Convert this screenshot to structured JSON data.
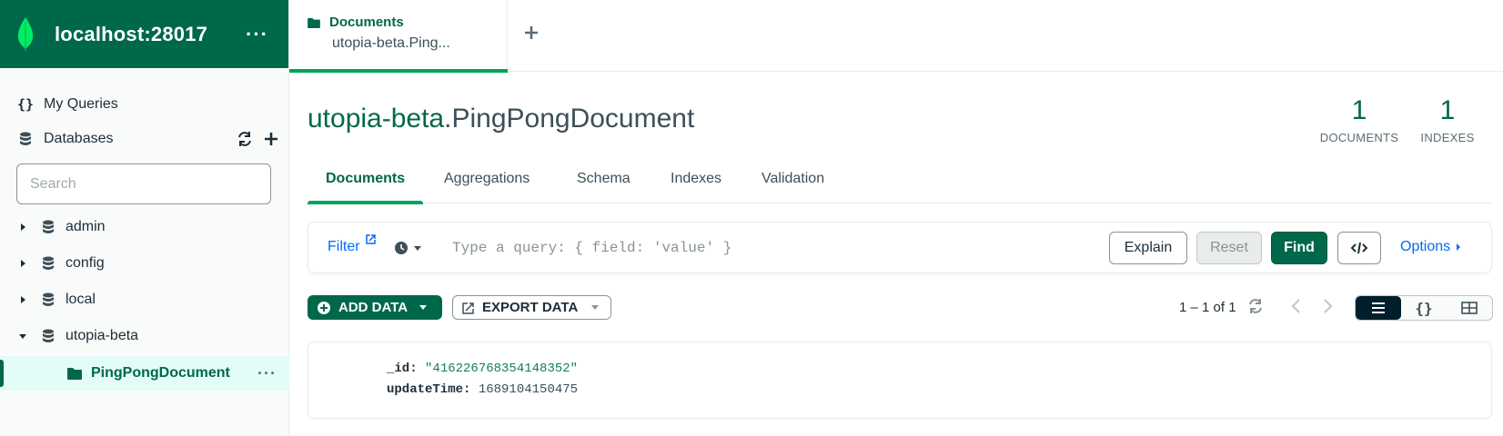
{
  "sidebar": {
    "connection_title": "localhost:28017",
    "menu_dots": "···",
    "my_queries_label": "My Queries",
    "databases_label": "Databases",
    "search_placeholder": "Search",
    "databases": [
      {
        "name": "admin",
        "expanded": false
      },
      {
        "name": "config",
        "expanded": false
      },
      {
        "name": "local",
        "expanded": false
      },
      {
        "name": "utopia-beta",
        "expanded": true
      }
    ],
    "selected_collection": "PingPongDocument",
    "collection_dots": "···"
  },
  "top_tab": {
    "title": "Documents",
    "subtitle": "utopia-beta.Ping..."
  },
  "header": {
    "db": "utopia-beta",
    "collection": ".PingPongDocument",
    "documents_count": "1",
    "documents_label": "DOCUMENTS",
    "indexes_count": "1",
    "indexes_label": "INDEXES"
  },
  "sub_tabs": [
    "Documents",
    "Aggregations",
    "Schema",
    "Indexes",
    "Validation"
  ],
  "query_bar": {
    "filter_label": "Filter",
    "placeholder": "Type a query: { field: 'value' }",
    "explain_label": "Explain",
    "reset_label": "Reset",
    "find_label": "Find",
    "options_label": "Options"
  },
  "toolbar": {
    "add_data_label": "ADD DATA",
    "export_data_label": "EXPORT DATA",
    "pagination": "1 – 1 of 1"
  },
  "document": {
    "id_key": "_id:",
    "id_value": "\"416226768354148352\"",
    "update_key": "updateTime:",
    "update_value": "1689104150475"
  },
  "colors": {
    "brand_green": "#00684a",
    "accent_green": "#00a35c",
    "link_blue": "#016bf8",
    "dark": "#001e2b"
  },
  "icons": {
    "logo": "mongodb-leaf-icon",
    "queries": "curly-braces-icon",
    "database": "database-icon",
    "refresh": "refresh-icon",
    "add": "plus-icon",
    "folder": "folder-icon",
    "clock": "clock-icon",
    "code": "code-icon"
  }
}
